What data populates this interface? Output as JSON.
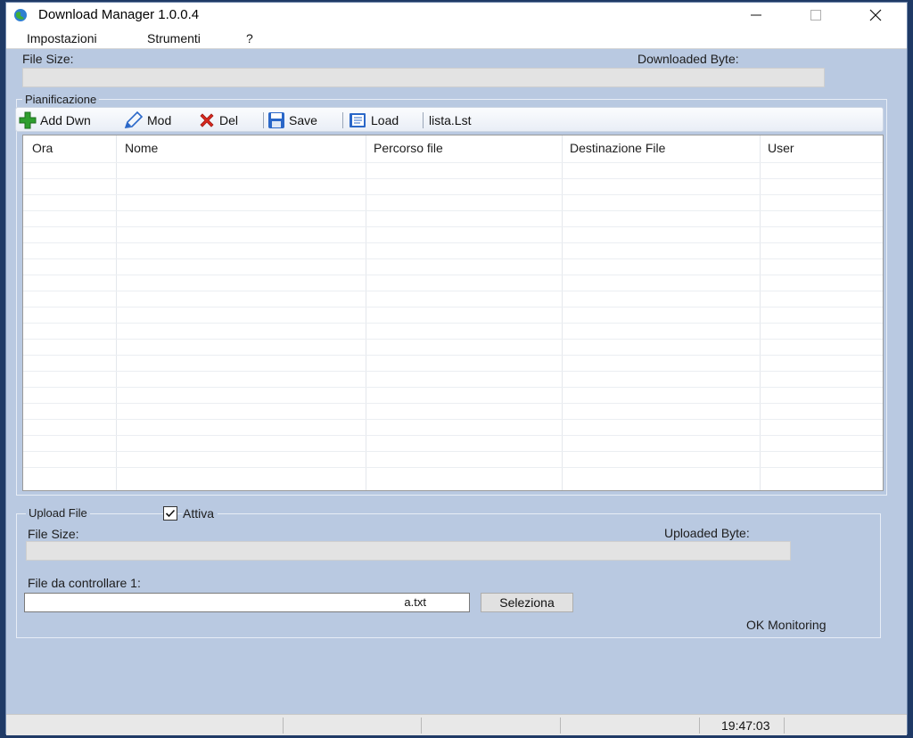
{
  "window": {
    "title": "Download Manager 1.0.0.4"
  },
  "menu": [
    "Impostazioni",
    "Strumenti",
    "?"
  ],
  "download": {
    "file_size_label": "File Size:",
    "downloaded_label": "Downloaded Byte:"
  },
  "schedule": {
    "group_title": "Pianificazione",
    "toolbar": {
      "add": "Add Dwn",
      "mod": "Mod",
      "del": "Del",
      "save": "Save",
      "load": "Load",
      "list_name": "lista.Lst"
    },
    "columns": [
      "Ora",
      "Nome",
      "Percorso file",
      "Destinazione File",
      "User"
    ]
  },
  "upload": {
    "group_title": "Upload File",
    "attiva_label": "Attiva",
    "attiva_checked": true,
    "file_size_label": "File Size:",
    "uploaded_label": "Uploaded Byte:",
    "file_label": "File da controllare 1:",
    "file_value_end": "a.txt",
    "select_button": "Seleziona",
    "status": "OK Monitoring"
  },
  "statusbar": {
    "time": "19:47:03"
  },
  "icons": {
    "app": "globe-icon",
    "add": "plus-icon",
    "mod": "pencil-icon",
    "del": "x-icon",
    "save": "floppy-icon",
    "load": "book-icon"
  },
  "colors": {
    "background": "#b9c9e1",
    "add_green": "#2e9e2e",
    "del_red": "#d9281f",
    "save_blue": "#2a67c8"
  }
}
